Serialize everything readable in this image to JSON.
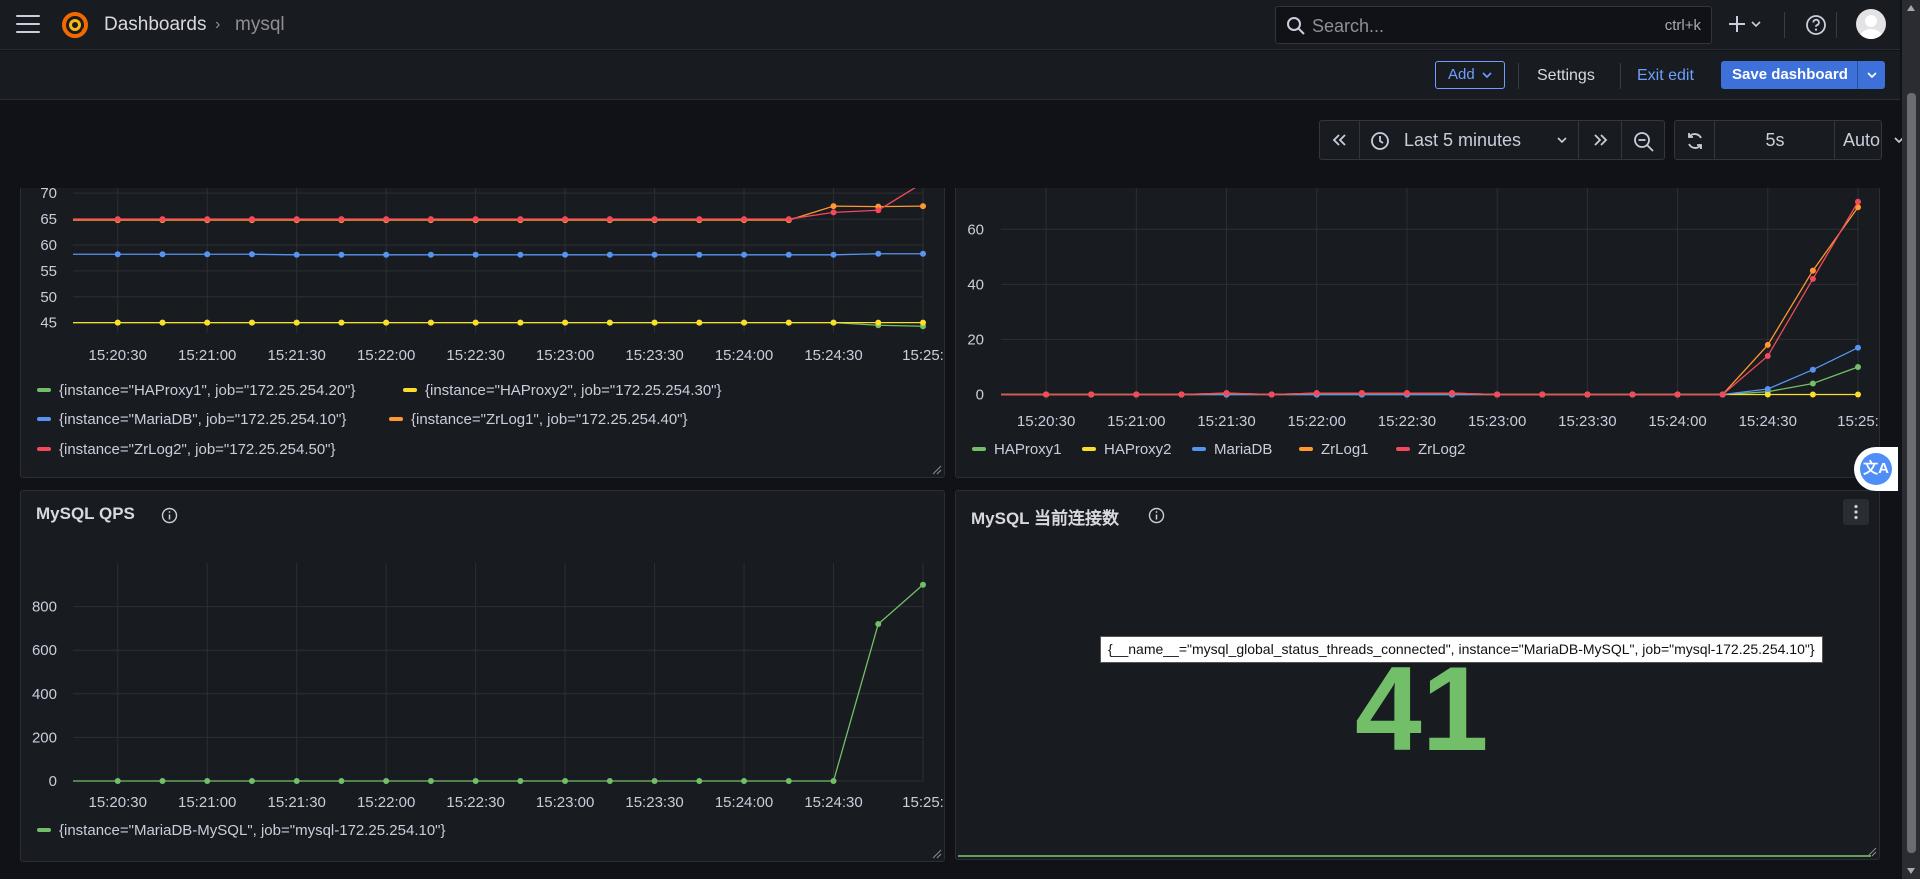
{
  "topbar": {
    "breadcrumb_root": "Dashboards",
    "breadcrumb_sep": "›",
    "breadcrumb_current": "mysql",
    "search_placeholder": "Search...",
    "search_shortcut": "ctrl+k"
  },
  "toolbar": {
    "add_label": "Add",
    "settings_label": "Settings",
    "exit_edit_label": "Exit edit",
    "save_label": "Save dashboard"
  },
  "timepicker": {
    "range": "Last 5 minutes",
    "refresh_interval": "5s",
    "auto_label": "Auto"
  },
  "panels": {
    "top_left": {
      "legend": [
        {
          "label": "{instance=\"HAProxy1\", job=\"172.25.254.20\"}",
          "color": "#73bf69"
        },
        {
          "label": "{instance=\"HAProxy2\", job=\"172.25.254.30\"}",
          "color": "#fade2a"
        },
        {
          "label": "{instance=\"MariaDB\", job=\"172.25.254.10\"}",
          "color": "#5794f2"
        },
        {
          "label": "{instance=\"ZrLog1\", job=\"172.25.254.40\"}",
          "color": "#ff9830"
        },
        {
          "label": "{instance=\"ZrLog2\", job=\"172.25.254.50\"}",
          "color": "#f2495c"
        }
      ]
    },
    "top_right": {
      "legend": [
        {
          "label": "HAProxy1",
          "color": "#73bf69"
        },
        {
          "label": "HAProxy2",
          "color": "#fade2a"
        },
        {
          "label": "MariaDB",
          "color": "#5794f2"
        },
        {
          "label": "ZrLog1",
          "color": "#ff9830"
        },
        {
          "label": "ZrLog2",
          "color": "#f2495c"
        }
      ]
    },
    "bottom_left": {
      "title": "MySQL QPS",
      "legend": [
        {
          "label": "{instance=\"MariaDB-MySQL\", job=\"mysql-172.25.254.10\"}",
          "color": "#73bf69"
        }
      ]
    },
    "bottom_right": {
      "title": "MySQL 当前连接数",
      "stat_value": "41",
      "stat_color": "#73bf69",
      "tooltip": "{__name__=\"mysql_global_status_threads_connected\", instance=\"MariaDB-MySQL\", job=\"mysql-172.25.254.10\"}"
    }
  },
  "translate_badge": "文A",
  "chart_data": [
    {
      "type": "line",
      "x": [
        "15:20:15",
        "15:20:30",
        "15:20:45",
        "15:21:00",
        "15:21:15",
        "15:21:30",
        "15:21:45",
        "15:22:00",
        "15:22:15",
        "15:22:30",
        "15:22:45",
        "15:23:00",
        "15:23:15",
        "15:23:30",
        "15:23:45",
        "15:24:00",
        "15:24:15",
        "15:24:30",
        "15:24:45",
        "15:25:00"
      ],
      "xticks": [
        "15:20:30",
        "15:21:00",
        "15:21:30",
        "15:22:00",
        "15:22:30",
        "15:23:00",
        "15:23:30",
        "15:24:00",
        "15:24:30",
        "15:25:"
      ],
      "yticks": [
        45,
        50,
        55,
        60,
        65,
        70
      ],
      "ylim": [
        43,
        71
      ],
      "series": [
        {
          "name": "{instance=\"HAProxy1\", job=\"172.25.254.20\"}",
          "color": "#73bf69",
          "values": [
            45,
            45,
            45,
            45,
            45,
            45,
            45,
            45,
            45,
            45,
            45,
            45,
            45,
            45,
            45,
            45,
            45,
            45,
            44.5,
            44.3
          ]
        },
        {
          "name": "{instance=\"HAProxy2\", job=\"172.25.254.30\"}",
          "color": "#fade2a",
          "values": [
            45,
            45,
            45,
            45,
            45,
            45,
            45,
            45,
            45,
            45,
            45,
            45,
            45,
            45,
            45,
            45,
            45,
            45,
            45,
            45
          ]
        },
        {
          "name": "{instance=\"MariaDB\", job=\"172.25.254.10\"}",
          "color": "#5794f2",
          "values": [
            58.2,
            58.2,
            58.2,
            58.2,
            58.2,
            58.1,
            58.1,
            58.1,
            58.1,
            58.1,
            58.1,
            58.1,
            58.1,
            58.1,
            58.1,
            58.1,
            58.1,
            58.1,
            58.3,
            58.3
          ]
        },
        {
          "name": "{instance=\"ZrLog1\", job=\"172.25.254.40\"}",
          "color": "#ff9830",
          "values": [
            64.8,
            64.8,
            64.8,
            64.8,
            64.8,
            64.8,
            64.8,
            64.8,
            64.8,
            64.8,
            64.8,
            64.8,
            64.8,
            64.8,
            64.8,
            64.8,
            64.8,
            67.5,
            67.4,
            67.5
          ]
        },
        {
          "name": "{instance=\"ZrLog2\", job=\"172.25.254.50\"}",
          "color": "#f2495c",
          "values": [
            65.0,
            65.0,
            65.0,
            65.0,
            65.0,
            65.0,
            65.0,
            65.0,
            65.0,
            65.0,
            65.0,
            65.0,
            65.0,
            65.0,
            65.0,
            65.0,
            65.0,
            66.3,
            66.7,
            72.0
          ]
        }
      ]
    },
    {
      "type": "line",
      "x": [
        "15:20:15",
        "15:20:30",
        "15:20:45",
        "15:21:00",
        "15:21:15",
        "15:21:30",
        "15:21:45",
        "15:22:00",
        "15:22:15",
        "15:22:30",
        "15:22:45",
        "15:23:00",
        "15:23:15",
        "15:23:30",
        "15:23:45",
        "15:24:00",
        "15:24:15",
        "15:24:30",
        "15:24:45",
        "15:25:00"
      ],
      "xticks": [
        "15:20:30",
        "15:21:00",
        "15:21:30",
        "15:22:00",
        "15:22:30",
        "15:23:00",
        "15:23:30",
        "15:24:00",
        "15:24:30",
        "15:25:"
      ],
      "yticks": [
        0,
        20,
        40,
        60
      ],
      "ylim": [
        -2,
        75
      ],
      "series": [
        {
          "name": "HAProxy1",
          "color": "#73bf69",
          "values": [
            0,
            0,
            0,
            0,
            0,
            0,
            0,
            0,
            0,
            0,
            0,
            0,
            0,
            0,
            0,
            0,
            0,
            1,
            4,
            10
          ]
        },
        {
          "name": "HAProxy2",
          "color": "#fade2a",
          "values": [
            0,
            0,
            0,
            0,
            0,
            0,
            0,
            0,
            0,
            0,
            0,
            0,
            0,
            0,
            0,
            0,
            0,
            0,
            0,
            0
          ]
        },
        {
          "name": "MariaDB",
          "color": "#5794f2",
          "values": [
            0,
            0,
            0,
            0,
            0,
            0,
            0,
            0,
            0,
            0,
            0,
            0,
            0,
            0,
            0,
            0,
            0,
            2,
            9,
            17
          ]
        },
        {
          "name": "ZrLog1",
          "color": "#ff9830",
          "values": [
            0,
            0,
            0,
            0,
            0,
            0.5,
            0,
            0.5,
            0.5,
            0.5,
            0.5,
            0,
            0,
            0,
            0,
            0,
            0,
            18,
            45,
            68
          ]
        },
        {
          "name": "ZrLog2",
          "color": "#f2495c",
          "values": [
            0,
            0,
            0,
            0,
            0,
            0.5,
            0,
            0.5,
            0.5,
            0.5,
            0.5,
            0,
            0,
            0,
            0,
            0,
            0,
            14,
            42,
            70
          ]
        }
      ]
    },
    {
      "type": "line",
      "title": "MySQL QPS",
      "x": [
        "15:20:15",
        "15:20:30",
        "15:20:45",
        "15:21:00",
        "15:21:15",
        "15:21:30",
        "15:21:45",
        "15:22:00",
        "15:22:15",
        "15:22:30",
        "15:22:45",
        "15:23:00",
        "15:23:15",
        "15:23:30",
        "15:23:45",
        "15:24:00",
        "15:24:15",
        "15:24:30",
        "15:24:45",
        "15:25:00"
      ],
      "xticks": [
        "15:20:30",
        "15:21:00",
        "15:21:30",
        "15:22:00",
        "15:22:30",
        "15:23:00",
        "15:23:30",
        "15:24:00",
        "15:24:30",
        "15:25:"
      ],
      "yticks": [
        0,
        200,
        400,
        600,
        800
      ],
      "ylim": [
        0,
        1000
      ],
      "series": [
        {
          "name": "{instance=\"MariaDB-MySQL\", job=\"mysql-172.25.254.10\"}",
          "color": "#73bf69",
          "values": [
            0,
            0,
            0,
            0,
            0,
            0,
            0,
            0,
            0,
            0,
            0,
            0,
            0,
            0,
            0,
            0,
            0,
            0,
            720,
            900
          ]
        }
      ]
    }
  ]
}
